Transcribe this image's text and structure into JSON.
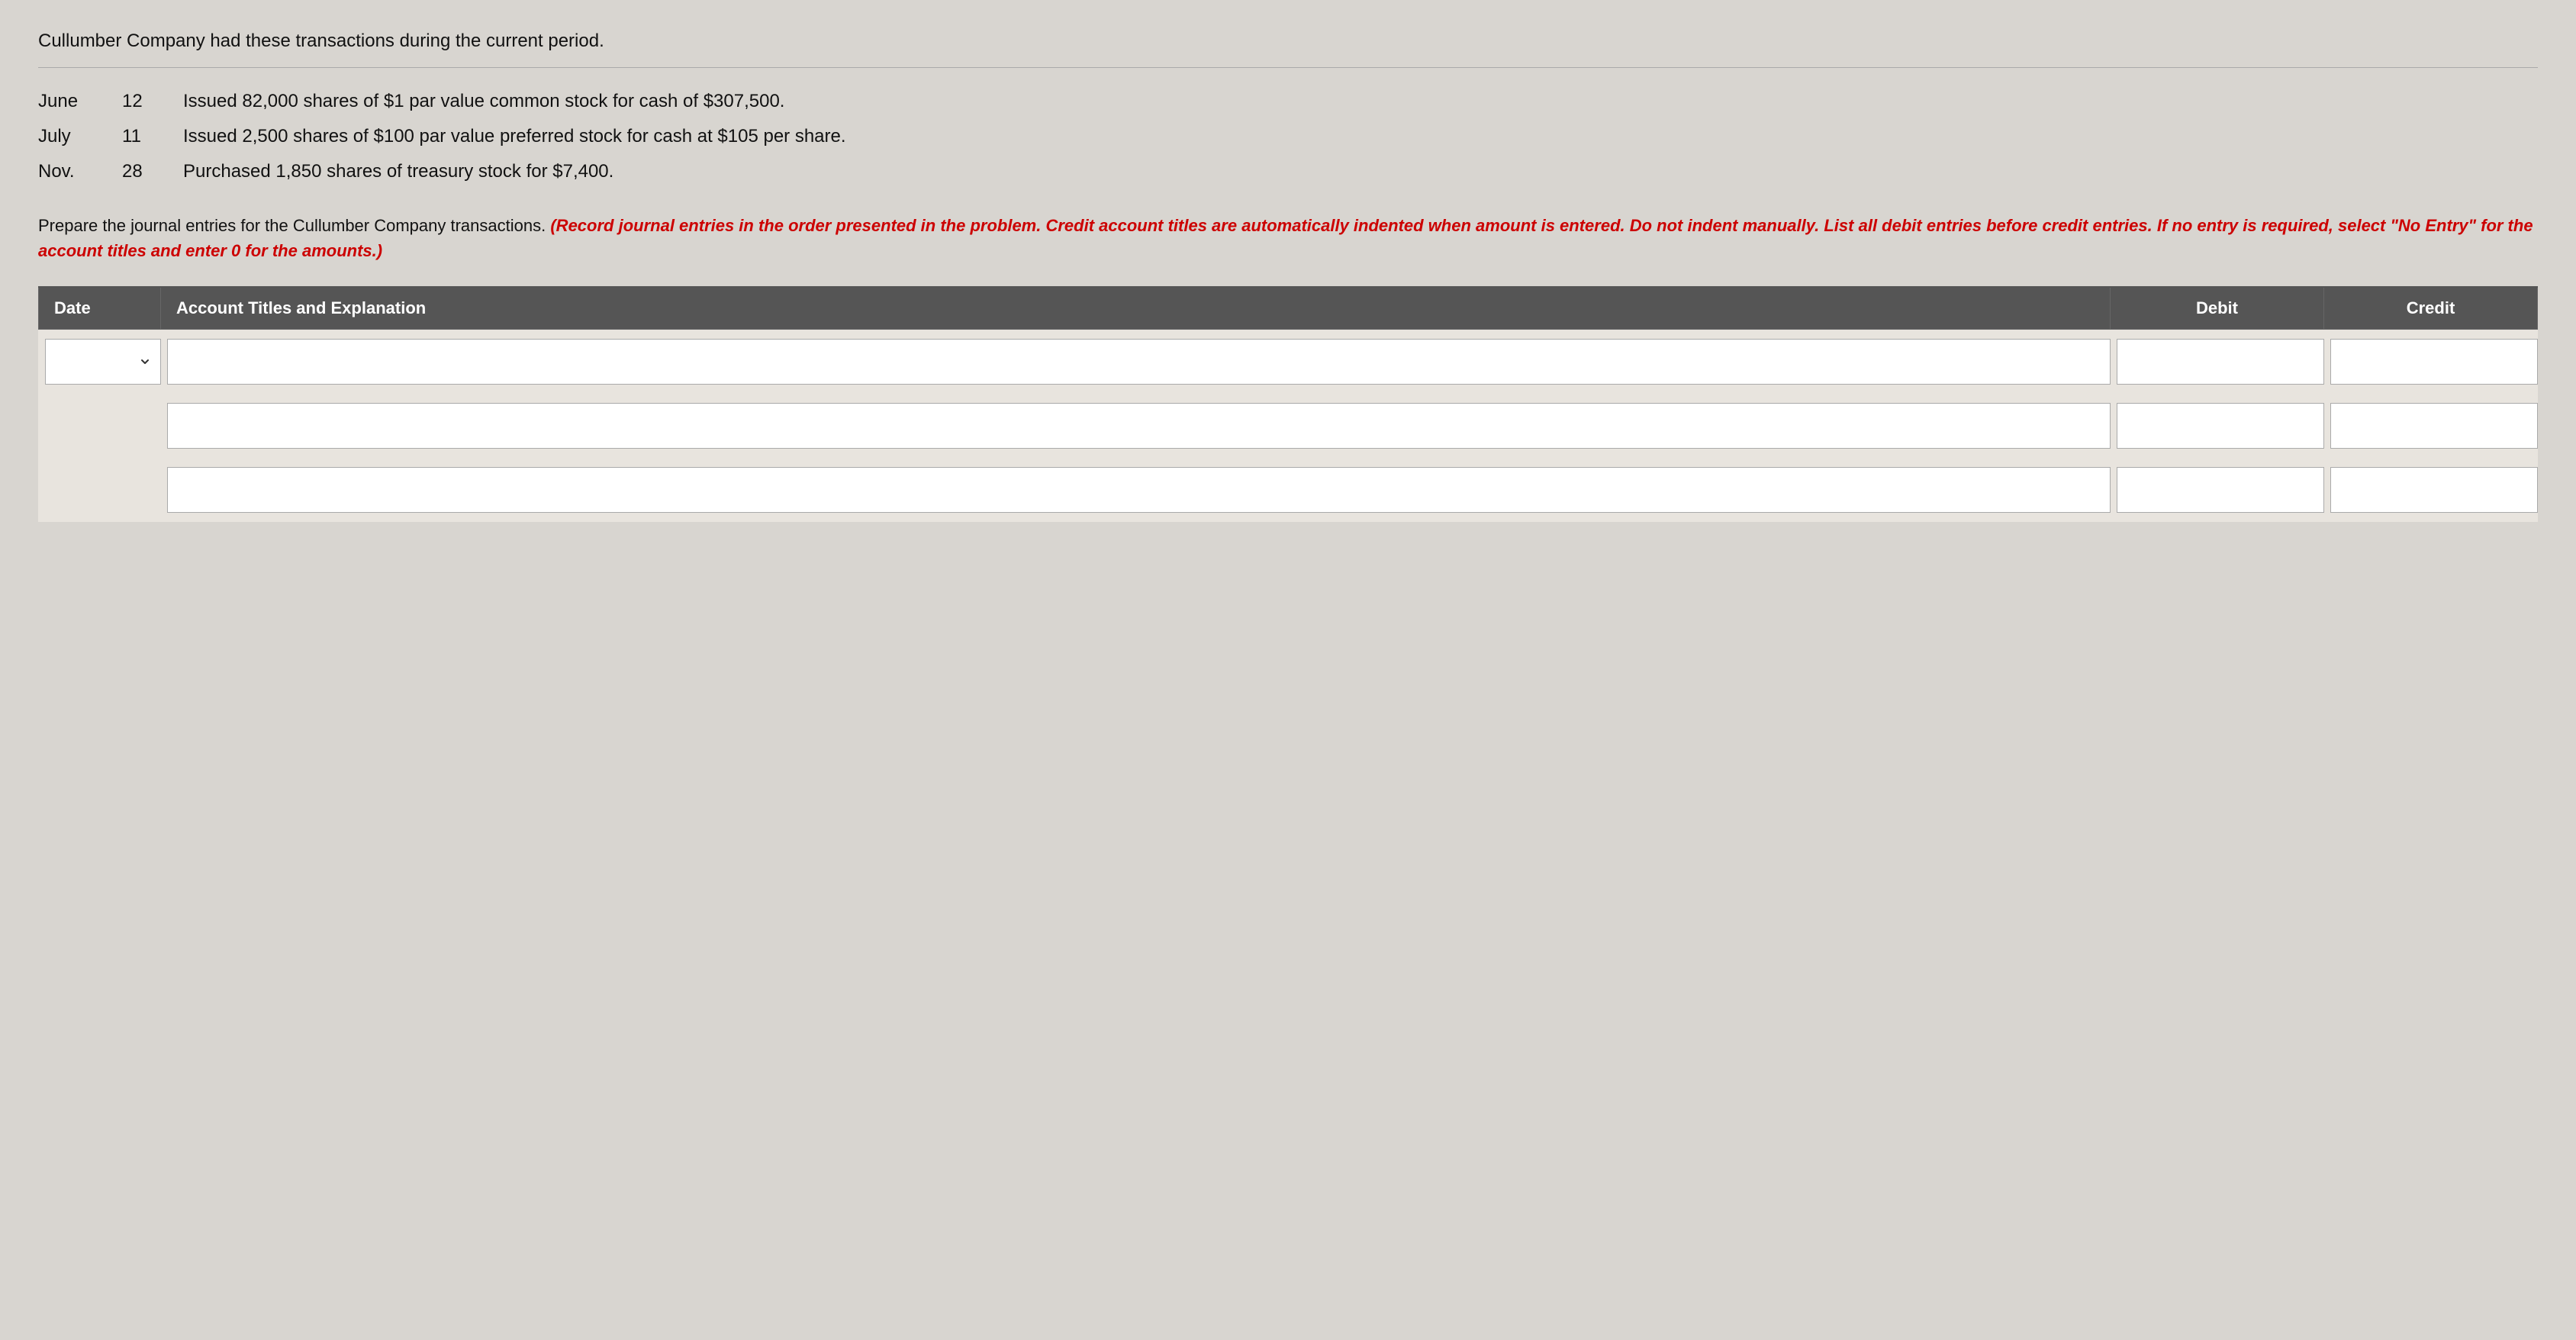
{
  "intro": {
    "text": "Cullumber Company had these transactions during the current period."
  },
  "transactions": [
    {
      "month": "June",
      "day": "12",
      "description": "Issued 82,000 shares of $1 par value common stock for cash of $307,500."
    },
    {
      "month": "July",
      "day": "11",
      "description": "Issued 2,500 shares of $100 par value preferred stock for cash at $105 per share."
    },
    {
      "month": "Nov.",
      "day": "28",
      "description": "Purchased 1,850 shares of treasury stock for $7,400."
    }
  ],
  "instructions": {
    "black_part": "Prepare the journal entries for the Cullumber Company transactions.",
    "red_part": "(Record journal entries in the order presented in the problem. Credit account titles are automatically indented when amount is entered. Do not indent manually. List all debit entries before credit entries. If no entry is required, select \"No Entry\" for the account titles and enter 0 for the amounts.)"
  },
  "table": {
    "headers": {
      "date": "Date",
      "account": "Account Titles and Explanation",
      "debit": "Debit",
      "credit": "Credit"
    },
    "rows": [
      {
        "date_placeholder": "",
        "account_placeholder": "",
        "debit_placeholder": "",
        "credit_placeholder": ""
      },
      {
        "date_placeholder": "",
        "account_placeholder": "",
        "debit_placeholder": "",
        "credit_placeholder": ""
      },
      {
        "date_placeholder": "",
        "account_placeholder": "",
        "debit_placeholder": "",
        "credit_placeholder": ""
      }
    ]
  }
}
